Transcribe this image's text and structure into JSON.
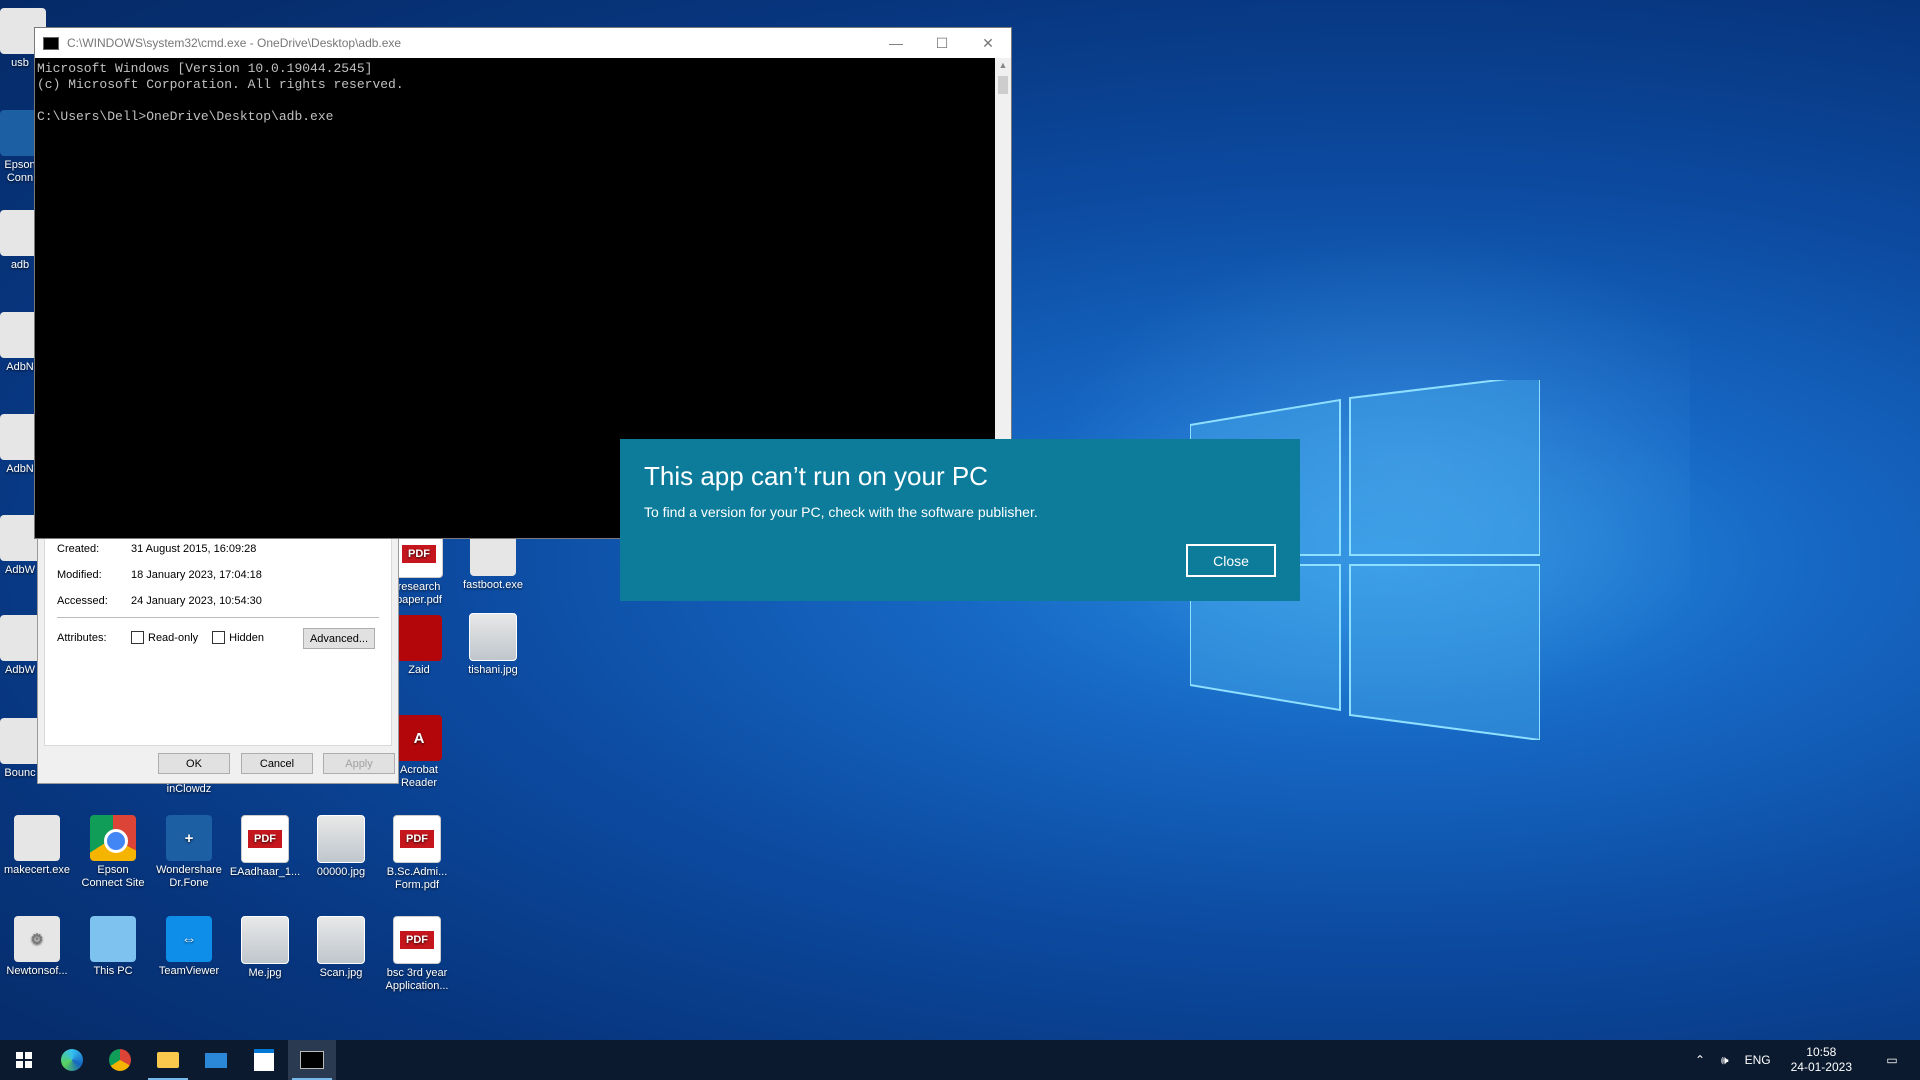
{
  "cmd_window": {
    "title": "C:\\WINDOWS\\system32\\cmd.exe - OneDrive\\Desktop\\adb.exe",
    "lines": [
      "Microsoft Windows [Version 10.0.19044.2545]",
      "(c) Microsoft Corporation. All rights reserved.",
      "",
      "C:\\Users\\Dell>OneDrive\\Desktop\\adb.exe"
    ],
    "minimize": "—",
    "maximize": "☐",
    "close": "✕"
  },
  "properties_dialog": {
    "created_label": "Created:",
    "created_value": "31 August 2015, 16:09:28",
    "modified_label": "Modified:",
    "modified_value": "18 January 2023, 17:04:18",
    "accessed_label": "Accessed:",
    "accessed_value": "24 January 2023, 10:54:30",
    "attributes_label": "Attributes:",
    "readonly_label": "Read-only",
    "hidden_label": "Hidden",
    "advanced_label": "Advanced...",
    "ok_label": "OK",
    "cancel_label": "Cancel",
    "apply_label": "Apply"
  },
  "error_dialog": {
    "title": "This app can’t run on your PC",
    "message": "To find a version for your PC, check with the software publisher.",
    "close_label": "Close",
    "color": "#0d7c9a"
  },
  "desktop_icons": {
    "row_a": [
      {
        "label": "makecert.exe",
        "icon": "exe-icon"
      },
      {
        "label": "Epson Connect Site",
        "icon": "chrome-icon"
      },
      {
        "label": "Wondershare Dr.Fone",
        "icon": "drfone-icon"
      },
      {
        "label": "EAadhaar_1...",
        "icon": "pdf-icon"
      },
      {
        "label": "00000.jpg",
        "icon": "photo-icon"
      },
      {
        "label": "B.Sc.Admi... Form.pdf",
        "icon": "pdf-icon"
      }
    ],
    "row_b": [
      {
        "label": "Newtonsof...",
        "icon": "gear-icon"
      },
      {
        "label": "This PC",
        "icon": "this-pc-icon"
      },
      {
        "label": "TeamViewer",
        "icon": "teamviewer-icon"
      },
      {
        "label": "Me.jpg",
        "icon": "image-icon"
      },
      {
        "label": "Scan.jpg",
        "icon": "photo-icon"
      },
      {
        "label": "bsc 3rd year Application...",
        "icon": "pdf-icon"
      }
    ],
    "middle": [
      {
        "label": "research paper.pdf",
        "icon": "pdf-icon"
      },
      {
        "label": "fastboot.exe",
        "icon": "exe-icon"
      },
      {
        "label": "Zaid",
        "icon": "folder-icon"
      },
      {
        "label": "tishani.jpg",
        "icon": "photo-icon"
      },
      {
        "label": "Acrobat Reader",
        "icon": "acrobat-icon"
      },
      {
        "label": "inClowdz",
        "icon": "app-icon"
      }
    ],
    "left_partial": [
      "usb",
      "Epson Conn",
      "adb",
      "AdbN",
      "AdbN",
      "AdbW",
      "AdbW",
      "Bounc"
    ]
  },
  "taskbar": {
    "tray_language": "ENG",
    "clock_time": "10:58",
    "clock_date": "24-01-2023"
  }
}
